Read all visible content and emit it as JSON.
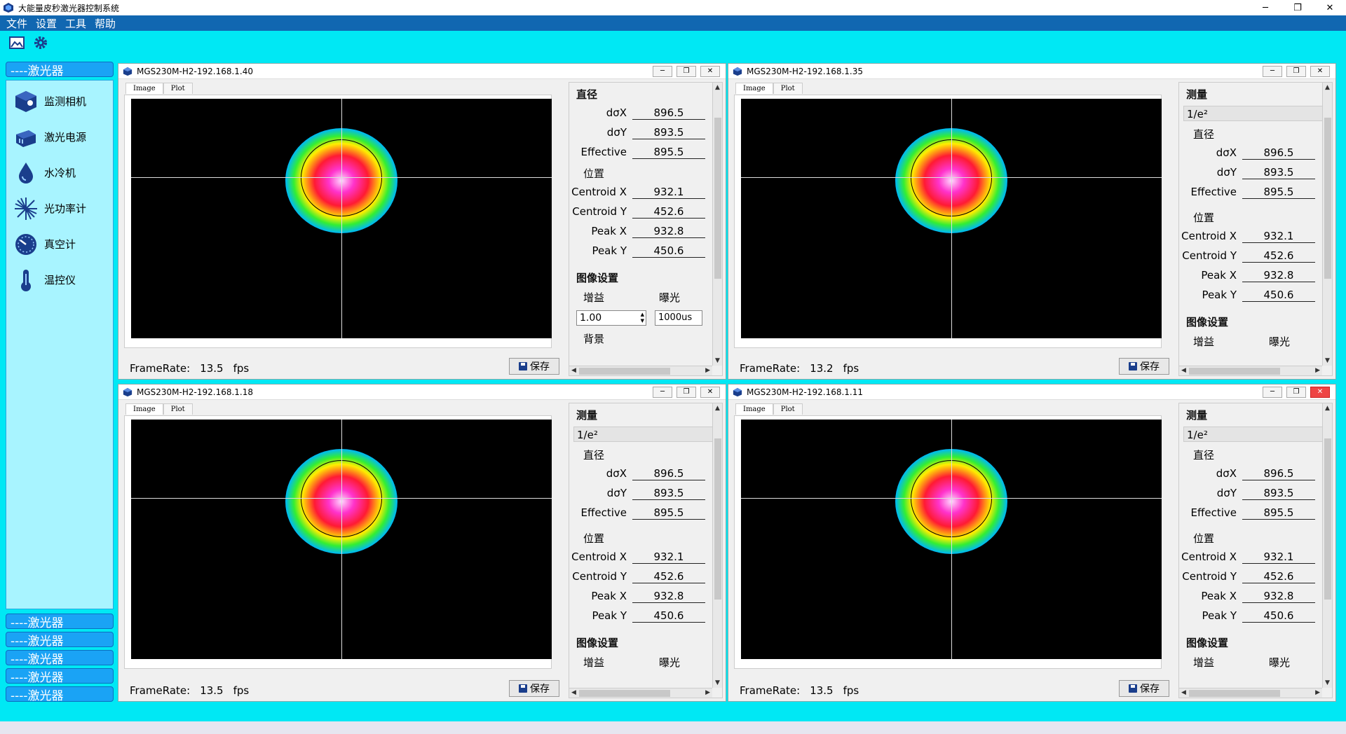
{
  "window": {
    "title": "大能量皮秒激光器控制系统",
    "min": "─",
    "max": "❐",
    "close": "✕"
  },
  "menu": [
    "文件",
    "设置",
    "工具",
    "帮助"
  ],
  "sidebar": {
    "top_group": "----激光器",
    "items": [
      "监测相机",
      "激光电源",
      "水冷机",
      "光功率计",
      "真空计",
      "温控仪"
    ],
    "groups": [
      "----激光器",
      "----激光器",
      "----激光器",
      "----激光器",
      "----激光器"
    ]
  },
  "labels": {
    "tab_image": "Image",
    "tab_plot": "Plot",
    "diameter": "直径",
    "position": "位置",
    "measure": "测量",
    "image_settings": "图像设置",
    "gain": "增益",
    "exposure": "曝光",
    "background": "背景",
    "mode": "1/e²",
    "dx": "dσX",
    "dy": "dσY",
    "eff": "Effective",
    "cx": "Centroid X",
    "cy": "Centroid Y",
    "px": "Peak X",
    "py": "Peak Y",
    "framerate": "FrameRate:",
    "fps": "fps",
    "save": "保存"
  },
  "windows": [
    {
      "title": "MGS230M-H2-192.168.1.40",
      "framerate": "13.5",
      "dx": "896.5",
      "dy": "893.5",
      "eff": "895.5",
      "cx": "932.1",
      "cy": "452.6",
      "px": "932.8",
      "py": "450.6",
      "gain": "1.00",
      "exposure": "1000us"
    },
    {
      "title": "MGS230M-H2-192.168.1.35",
      "framerate": "13.2",
      "dx": "896.5",
      "dy": "893.5",
      "eff": "895.5",
      "cx": "932.1",
      "cy": "452.6",
      "px": "932.8",
      "py": "450.6"
    },
    {
      "title": "MGS230M-H2-192.168.1.18",
      "framerate": "13.5",
      "dx": "896.5",
      "dy": "893.5",
      "eff": "895.5",
      "cx": "932.1",
      "cy": "452.6",
      "px": "932.8",
      "py": "450.6"
    },
    {
      "title": "MGS230M-H2-192.168.1.11",
      "framerate": "13.5",
      "dx": "896.5",
      "dy": "893.5",
      "eff": "895.5",
      "cx": "932.1",
      "cy": "452.6",
      "px": "932.8",
      "py": "450.6"
    }
  ]
}
